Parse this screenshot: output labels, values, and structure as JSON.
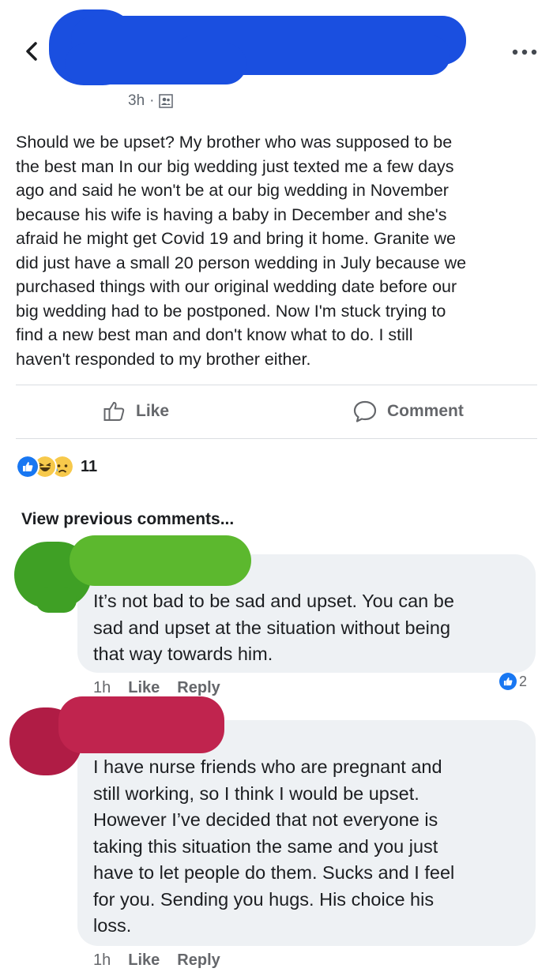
{
  "post": {
    "timestamp": "3h",
    "separator": "·",
    "audience_icon": "friends-icon",
    "text": "Should we be upset? My brother who was supposed to be\nthe best man In our big wedding just texted me a few days\nago and said he won't be at our big wedding in November\nbecause his wife is having a baby in December and she's\nafraid he might get Covid 19 and bring it home. Granite we\ndid just have a small 20 person wedding in July because we\npurchased things with our original wedding date before our\nbig wedding had to be postponed. Now I'm stuck trying to\nfind a new best man and don't know what to do. I still\nhaven't responded to my brother either."
  },
  "actions": {
    "like_label": "Like",
    "comment_label": "Comment"
  },
  "reactions": {
    "count": "11",
    "types": [
      "like-icon",
      "haha-icon",
      "sad-icon"
    ]
  },
  "view_previous": "View previous comments...",
  "comments": [
    {
      "text": "It’s not bad to be sad and upset. You can be\nsad and upset at the situation without being\nthat way towards him.",
      "time": "1h",
      "like_label": "Like",
      "reply_label": "Reply",
      "like_count": "2"
    },
    {
      "text": "I have nurse friends who are pregnant and\nstill working, so I think I would be upset.\nHowever I’ve decided that not everyone is\ntaking this situation the same and you just\nhave to let people do them. Sucks and I feel\nfor you. Sending you hugs. His choice his\nloss.",
      "time": "1h",
      "like_label": "Like",
      "reply_label": "Reply"
    }
  ],
  "colors": {
    "redaction_blue": "#1a4fe0",
    "redaction_green": "#5cb82e",
    "redaction_pink": "#c0244e",
    "like_blue": "#1877f2"
  }
}
